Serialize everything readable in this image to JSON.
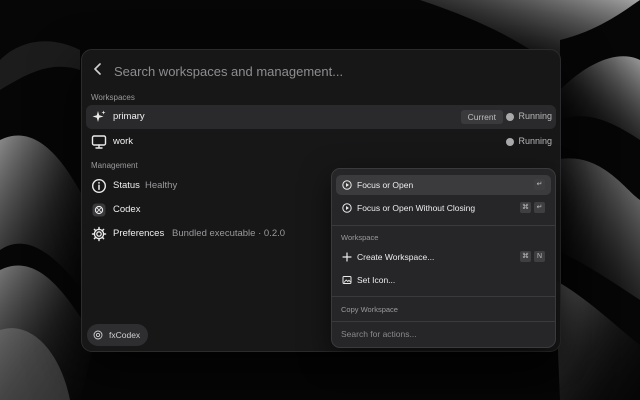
{
  "search": {
    "placeholder": "Search workspaces and management..."
  },
  "workspaces": {
    "header": "Workspaces",
    "items": [
      {
        "label": "primary",
        "badge": "Current",
        "status": "Running",
        "icon": "sparkle-icon"
      },
      {
        "label": "work",
        "status": "Running",
        "icon": "monitor-icon"
      }
    ]
  },
  "management": {
    "header": "Management",
    "items": [
      {
        "label": "Status",
        "detail": "Healthy",
        "icon": "info-icon"
      },
      {
        "label": "Codex",
        "icon": "codex-icon"
      },
      {
        "label": "Preferences",
        "detail": "Bundled executable · 0.2.0",
        "icon": "gear-icon"
      }
    ]
  },
  "footer": {
    "label": "fxCodex"
  },
  "actions": {
    "items": [
      {
        "label": "Focus or Open",
        "keys": [
          "↵"
        ],
        "icon": "play-circle-icon"
      },
      {
        "label": "Focus or Open Without Closing",
        "keys": [
          "⌘",
          "↵"
        ],
        "icon": "play-circle-icon"
      }
    ],
    "workspace_section": "Workspace",
    "workspace_items": [
      {
        "label": "Create Workspace...",
        "keys": [
          "⌘",
          "N"
        ],
        "icon": "plus-icon"
      },
      {
        "label": "Set Icon...",
        "icon": "image-icon"
      }
    ],
    "copy_section": "Copy Workspace",
    "search_placeholder": "Search for actions..."
  }
}
